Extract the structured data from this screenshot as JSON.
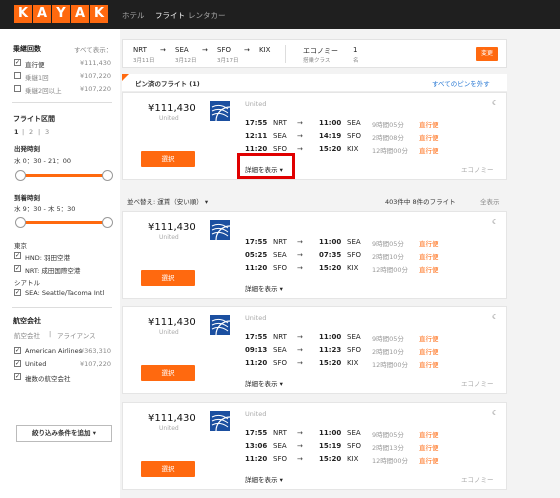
{
  "brand": {
    "letters": [
      "K",
      "A",
      "Y",
      "A",
      "K"
    ],
    "accent": "#ff690f"
  },
  "nav": [
    {
      "label": "ホテル"
    },
    {
      "label": "フライト"
    },
    {
      "label": "レンタカー"
    }
  ],
  "filters": {
    "stops": {
      "title": "乗継回数",
      "show_all": "すべて表示：",
      "options": [
        {
          "label": "直行便",
          "price": "¥111,430",
          "checked": true
        },
        {
          "label": "乗継1回",
          "price": "¥107,220",
          "checked": false
        },
        {
          "label": "乗継2回以上",
          "price": "¥107,220",
          "checked": false
        }
      ]
    },
    "flight_leg": {
      "title": "フライト区間",
      "legs": [
        "1",
        "2",
        "3"
      ]
    },
    "departure": {
      "title": "出発時刻",
      "range": "水 0：30 - 21：00"
    },
    "arrival": {
      "title": "到着時刻",
      "range": "水 9：30 - 木 5：30"
    },
    "tokyo": {
      "title": "東京",
      "options": [
        {
          "label": "HND: 羽田空港",
          "checked": true
        },
        {
          "label": "NRT: 成田国際空港",
          "checked": true
        }
      ]
    },
    "seattle": {
      "title": "シアトル",
      "options": [
        {
          "label": "SEA: Seattle/Tacoma Intl",
          "checked": true
        }
      ]
    },
    "airlines": {
      "title": "航空会社",
      "tabs": [
        "航空会社",
        "アライアンス"
      ],
      "options": [
        {
          "label": "American Airlines",
          "price": "¥363,310",
          "checked": true
        },
        {
          "label": "United",
          "price": "¥107,220",
          "checked": true
        },
        {
          "label": "複数の航空会社",
          "price": "",
          "checked": true
        }
      ]
    },
    "add_filter": "絞り込み条件を追加"
  },
  "search": {
    "legs": [
      {
        "code": "NRT",
        "date": "3月11日"
      },
      {
        "code": "SEA",
        "date": "3月12日"
      },
      {
        "code": "SFO",
        "date": "3月17日"
      },
      {
        "code": "KIX",
        "date": ""
      }
    ],
    "cabin": "エコノミー",
    "cabin_sub": "搭乗クラス",
    "pax": "1",
    "pax_sub": "名",
    "change": "変更"
  },
  "pinned": {
    "title": "ピン済のフライト (1)",
    "unpin": "すべてのピンを外す"
  },
  "sort": {
    "label": "並べ替え: 運賃（安い順）",
    "count": "403件中 8件のフライト",
    "show_all": "全表示"
  },
  "results": [
    {
      "price": "¥111,430",
      "airline": "United",
      "carrier": "United",
      "select": "選択",
      "details": "詳細を表示",
      "cabin": "エコノミー",
      "segments": [
        {
          "dep": "17:55",
          "from": "NRT",
          "arr": "11:00",
          "to": "SEA",
          "dur": "9時間05分",
          "type": "直行便"
        },
        {
          "dep": "12:11",
          "from": "SEA",
          "arr": "14:19",
          "to": "SFO",
          "dur": "2時間08分",
          "type": "直行便"
        },
        {
          "dep": "11:20",
          "from": "SFO",
          "arr": "15:20",
          "to": "KIX",
          "dur": "12時間00分",
          "type": "直行便"
        }
      ]
    },
    {
      "price": "¥111,430",
      "airline": "United",
      "carrier": "",
      "select": "選択",
      "details": "詳細を表示",
      "cabin": "",
      "segments": [
        {
          "dep": "17:55",
          "from": "NRT",
          "arr": "11:00",
          "to": "SEA",
          "dur": "9時間05分",
          "type": "直行便"
        },
        {
          "dep": "05:25",
          "from": "SEA",
          "arr": "07:35",
          "to": "SFO",
          "dur": "2時間10分",
          "type": "直行便"
        },
        {
          "dep": "11:20",
          "from": "SFO",
          "arr": "15:20",
          "to": "KIX",
          "dur": "12時間00分",
          "type": "直行便"
        }
      ]
    },
    {
      "price": "¥111,430",
      "airline": "United",
      "carrier": "United",
      "select": "選択",
      "details": "詳細を表示",
      "cabin": "エコノミー",
      "segments": [
        {
          "dep": "17:55",
          "from": "NRT",
          "arr": "11:00",
          "to": "SEA",
          "dur": "9時間05分",
          "type": "直行便"
        },
        {
          "dep": "09:13",
          "from": "SEA",
          "arr": "11:23",
          "to": "SFO",
          "dur": "2時間10分",
          "type": "直行便"
        },
        {
          "dep": "11:20",
          "from": "SFO",
          "arr": "15:20",
          "to": "KIX",
          "dur": "12時間00分",
          "type": "直行便"
        }
      ]
    },
    {
      "price": "¥111,430",
      "airline": "United",
      "carrier": "United",
      "select": "選択",
      "details": "詳細を表示",
      "cabin": "エコノミー",
      "segments": [
        {
          "dep": "17:55",
          "from": "NRT",
          "arr": "11:00",
          "to": "SEA",
          "dur": "9時間05分",
          "type": "直行便"
        },
        {
          "dep": "13:06",
          "from": "SEA",
          "arr": "15:19",
          "to": "SFO",
          "dur": "2時間13分",
          "type": "直行便"
        },
        {
          "dep": "11:20",
          "from": "SFO",
          "arr": "15:20",
          "to": "KIX",
          "dur": "12時間00分",
          "type": "直行便"
        }
      ]
    }
  ]
}
